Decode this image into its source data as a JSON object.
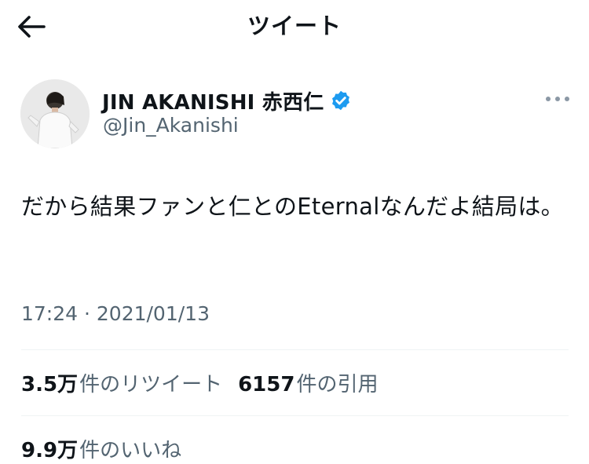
{
  "header": {
    "title": "ツイート"
  },
  "tweet": {
    "author": {
      "display_name": "JIN AKANISHI 赤西仁",
      "handle": "@Jin_Akanishi",
      "verified": true
    },
    "text": "だから結果ファンと仁とのEternalなんだよ結局は。",
    "timestamp": "17:24 · 2021/01/13"
  },
  "stats": {
    "retweets": {
      "count": "3.5万",
      "label": "件のリツイート"
    },
    "quotes": {
      "count": "6157",
      "label": "件の引用"
    },
    "likes": {
      "count": "9.9万",
      "label": "件のいいね"
    }
  },
  "colors": {
    "text_primary": "#0f1419",
    "text_secondary": "#536471",
    "verified_blue": "#1d9bf0",
    "divider": "#eff3f4"
  },
  "icons": {
    "back": "arrow-left-icon",
    "verified": "verified-badge-icon",
    "more": "more-horizontal-icon"
  }
}
